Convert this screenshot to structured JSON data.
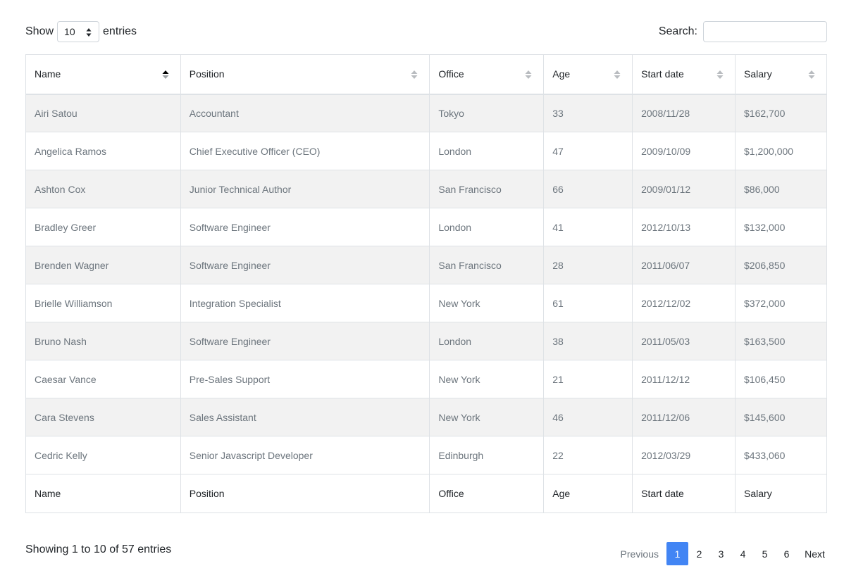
{
  "length": {
    "prefix": "Show",
    "value": "10",
    "suffix": "entries"
  },
  "search": {
    "label": "Search:",
    "value": ""
  },
  "columns": [
    "Name",
    "Position",
    "Office",
    "Age",
    "Start date",
    "Salary"
  ],
  "sort": {
    "column": "Name",
    "direction": "asc"
  },
  "rows": [
    [
      "Airi Satou",
      "Accountant",
      "Tokyo",
      "33",
      "2008/11/28",
      "$162,700"
    ],
    [
      "Angelica Ramos",
      "Chief Executive Officer (CEO)",
      "London",
      "47",
      "2009/10/09",
      "$1,200,000"
    ],
    [
      "Ashton Cox",
      "Junior Technical Author",
      "San Francisco",
      "66",
      "2009/01/12",
      "$86,000"
    ],
    [
      "Bradley Greer",
      "Software Engineer",
      "London",
      "41",
      "2012/10/13",
      "$132,000"
    ],
    [
      "Brenden Wagner",
      "Software Engineer",
      "San Francisco",
      "28",
      "2011/06/07",
      "$206,850"
    ],
    [
      "Brielle Williamson",
      "Integration Specialist",
      "New York",
      "61",
      "2012/12/02",
      "$372,000"
    ],
    [
      "Bruno Nash",
      "Software Engineer",
      "London",
      "38",
      "2011/05/03",
      "$163,500"
    ],
    [
      "Caesar Vance",
      "Pre-Sales Support",
      "New York",
      "21",
      "2011/12/12",
      "$106,450"
    ],
    [
      "Cara Stevens",
      "Sales Assistant",
      "New York",
      "46",
      "2011/12/06",
      "$145,600"
    ],
    [
      "Cedric Kelly",
      "Senior Javascript Developer",
      "Edinburgh",
      "22",
      "2012/03/29",
      "$433,060"
    ]
  ],
  "footer_columns": [
    "Name",
    "Position",
    "Office",
    "Age",
    "Start date",
    "Salary"
  ],
  "info": "Showing 1 to 10 of 57 entries",
  "pagination": {
    "previous": "Previous",
    "pages": [
      "1",
      "2",
      "3",
      "4",
      "5",
      "6"
    ],
    "active": "1",
    "next": "Next"
  },
  "colors": {
    "accent": "#4285f4",
    "stripe": "#f2f2f2",
    "border": "#dee2e6"
  }
}
